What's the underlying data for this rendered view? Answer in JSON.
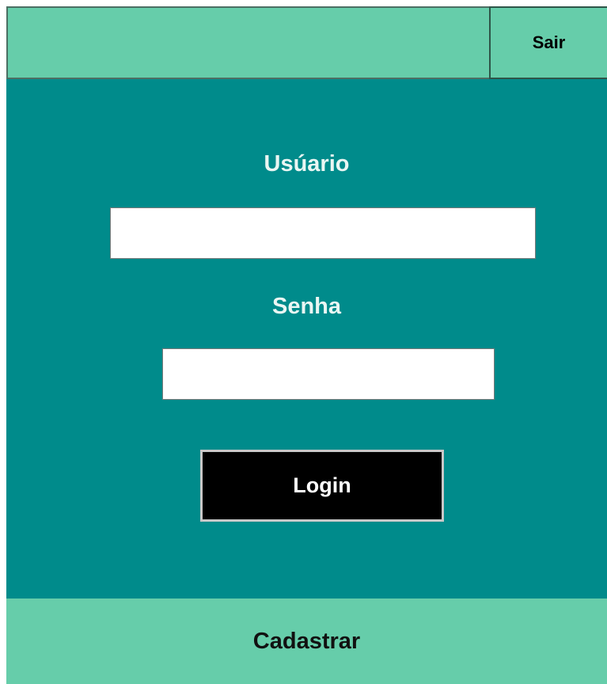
{
  "header": {
    "exit_label": "Sair"
  },
  "login_form": {
    "username_label": "Usúario",
    "username_value": "",
    "password_label": "Senha",
    "password_value": "",
    "login_label": "Login"
  },
  "footer": {
    "register_label": "Cadastrar"
  },
  "colors": {
    "header_bg": "#66cdaa",
    "panel_bg": "#008b8b",
    "login_button_bg": "#000000",
    "footer_bg": "#66cdaa"
  }
}
